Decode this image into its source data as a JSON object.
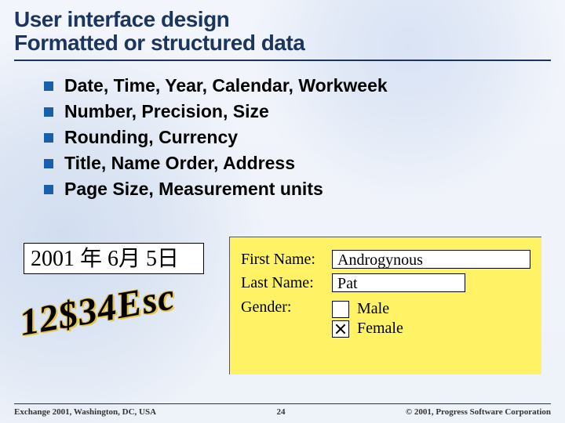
{
  "title_line1": "User interface design",
  "title_line2": "Formatted or structured data",
  "bullets": [
    "Date, Time, Year, Calendar, Workweek",
    "Number, Precision, Size",
    "Rounding, Currency",
    "Title, Name Order, Address",
    "Page Size, Measurement units"
  ],
  "examples": {
    "date_text": "2001 年 6月 5日",
    "escudo_text": "12$34Esc",
    "form": {
      "first_name_label": "First Name:",
      "first_name_value": "Androgynous",
      "last_name_label": "Last Name:",
      "last_name_value": "Pat",
      "gender_label": "Gender:",
      "male_label": "Male",
      "female_label": "Female",
      "male_checked": false,
      "female_checked": true
    }
  },
  "footer": {
    "left": "Exchange 2001, Washington, DC, USA",
    "center": "24",
    "right": "© 2001, Progress Software Corporation"
  }
}
